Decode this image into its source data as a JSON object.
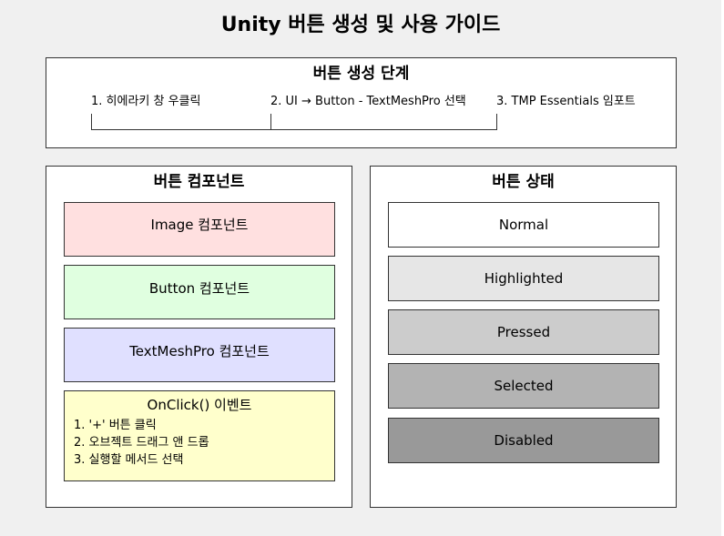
{
  "title": "Unity 버튼 생성 및 사용 가이드",
  "steps_panel": {
    "title": "버튼 생성 단계",
    "steps": [
      "1. 히에라키 창 우클릭",
      "2. UI → Button - TextMeshPro 선택",
      "3. TMP Essentials 임포트"
    ]
  },
  "components_panel": {
    "title": "버튼 컴포넌트",
    "items": [
      {
        "label": "Image 컴포넌트",
        "color": "#ffe0e0"
      },
      {
        "label": "Button 컴포넌트",
        "color": "#e0ffe0"
      },
      {
        "label": "TextMeshPro 컴포넌트",
        "color": "#e0e0ff"
      }
    ],
    "event": {
      "title": "OnClick() 이벤트",
      "color": "#ffffcc",
      "lines": [
        "1. '+' 버튼 클릭",
        "2. 오브젝트 드래그 앤 드롭",
        "3. 실행할 메서드 선택"
      ]
    }
  },
  "states_panel": {
    "title": "버튼 상태",
    "states": [
      {
        "label": "Normal",
        "color": "#ffffff"
      },
      {
        "label": "Highlighted",
        "color": "#e6e6e6"
      },
      {
        "label": "Pressed",
        "color": "#cccccc"
      },
      {
        "label": "Selected",
        "color": "#b3b3b3"
      },
      {
        "label": "Disabled",
        "color": "#999999"
      }
    ]
  }
}
